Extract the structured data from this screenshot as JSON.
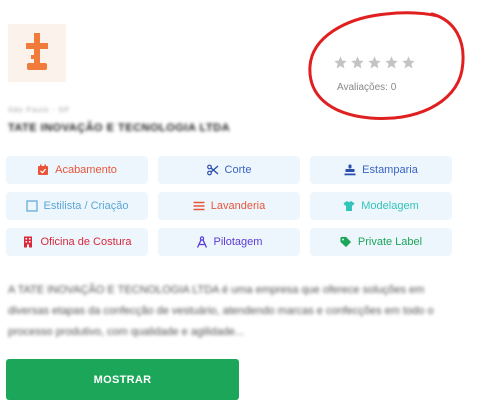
{
  "logo": {
    "letter": "t",
    "color": "#f07b3a"
  },
  "rating": {
    "stars": 0,
    "max_stars": 5,
    "label": "Avaliações: 0",
    "circle_color": "#e02020"
  },
  "company": {
    "small_label": "São Paulo - SP",
    "name": "TATE INOVAÇÃO E TECNOLOGIA LTDA"
  },
  "tags": [
    {
      "label": "Acabamento",
      "icon": "badge-check-icon",
      "color": "#e8553a"
    },
    {
      "label": "Corte",
      "icon": "scissors-icon",
      "color": "#3a64c4"
    },
    {
      "label": "Estamparia",
      "icon": "stamp-icon",
      "color": "#3a64c4"
    },
    {
      "label": "Estilista / Criação",
      "icon": "square-outline-icon",
      "color": "#5aa6d6"
    },
    {
      "label": "Lavanderia",
      "icon": "waves-icon",
      "color": "#e8553a"
    },
    {
      "label": "Modelagem",
      "icon": "shirt-icon",
      "color": "#33c4b8"
    },
    {
      "label": "Oficina de Costura",
      "icon": "building-icon",
      "color": "#d9283a"
    },
    {
      "label": "Pilotagem",
      "icon": "drafting-compass-icon",
      "color": "#5a3ad6"
    },
    {
      "label": "Private Label",
      "icon": "tag-icon",
      "color": "#1ca65a"
    }
  ],
  "description": "A TATE INOVAÇÃO E TECNOLOGIA LTDA é uma empresa que oferece soluções em diversas etapas da confecção de vestuário, atendendo marcas e confecções em todo o processo produtivo, com qualidade e agilidade...",
  "button": {
    "label": "MOSTRAR",
    "color": "#1ca65a"
  }
}
